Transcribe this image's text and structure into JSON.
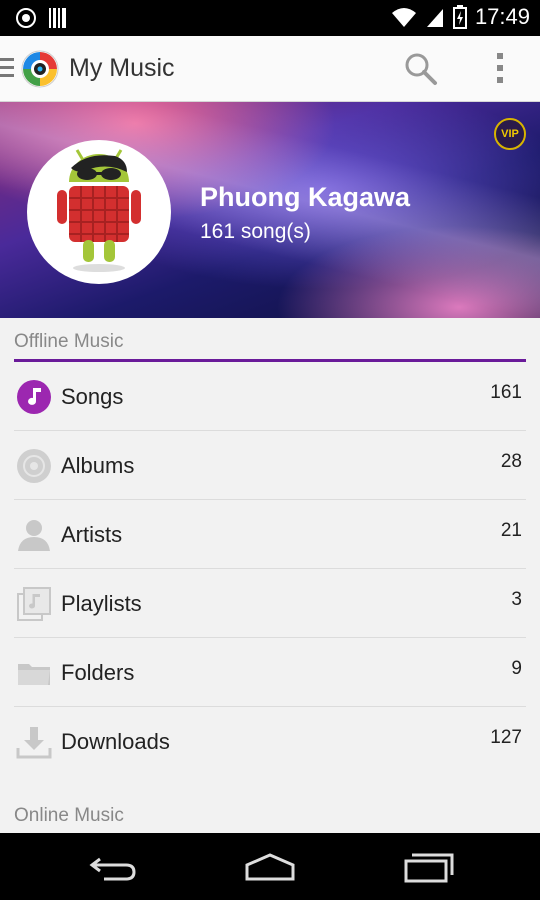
{
  "status_bar": {
    "time": "17:49",
    "icons": [
      "app-notification-icon",
      "barcode-icon",
      "wifi-icon",
      "signal-icon",
      "battery-charging-icon"
    ]
  },
  "app_bar": {
    "title": "My Music",
    "icons": [
      "hamburger-icon",
      "app-logo-icon",
      "search-icon",
      "overflow-menu-icon"
    ]
  },
  "profile": {
    "name": "Phuong Kagawa",
    "song_count": "161 song(s)",
    "badge": "VIP"
  },
  "offline_section": {
    "title": "Offline Music",
    "items": [
      {
        "label": "Songs",
        "count": "161",
        "icon": "music-note-icon"
      },
      {
        "label": "Albums",
        "count": "28",
        "icon": "disc-icon"
      },
      {
        "label": "Artists",
        "count": "21",
        "icon": "person-icon"
      },
      {
        "label": "Playlists",
        "count": "3",
        "icon": "playlist-icon"
      },
      {
        "label": "Folders",
        "count": "9",
        "icon": "folder-icon"
      },
      {
        "label": "Downloads",
        "count": "127",
        "icon": "download-icon"
      }
    ]
  },
  "online_section": {
    "title": "Online Music"
  },
  "colors": {
    "accent": "#6a1b9a",
    "songs_icon": "#9c27b0"
  }
}
